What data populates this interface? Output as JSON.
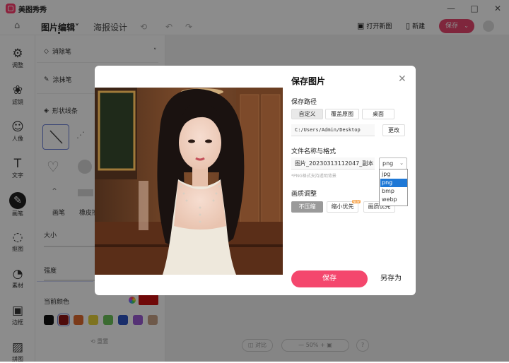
{
  "app": {
    "name": "美图秀秀"
  },
  "window_controls": {
    "minimize": "—",
    "maximize": "□",
    "close": "✕"
  },
  "topbar": {
    "tabs": [
      {
        "label": "图片编辑",
        "caret": "˅"
      },
      {
        "label": "海报设计"
      }
    ],
    "open_new": "打开新图",
    "new": "新建",
    "save": "保存",
    "save_caret": "⌄"
  },
  "left_rail": {
    "items": [
      {
        "label": "调整",
        "icon": "adjust-icon",
        "glyph": "⚙"
      },
      {
        "label": "滤镜",
        "icon": "filter-icon",
        "glyph": "❀"
      },
      {
        "label": "人像",
        "icon": "portrait-icon",
        "glyph": "☺"
      },
      {
        "label": "文字",
        "icon": "text-icon",
        "glyph": "T"
      },
      {
        "label": "画笔",
        "icon": "brush-icon",
        "glyph": "✎",
        "active": true
      },
      {
        "label": "抠图",
        "icon": "cutout-icon",
        "glyph": "◌"
      },
      {
        "label": "素材",
        "icon": "sticker-icon",
        "glyph": "◔"
      },
      {
        "label": "边框",
        "icon": "frame-icon",
        "glyph": "▣"
      },
      {
        "label": "拼图",
        "icon": "collage-icon",
        "glyph": "▨"
      }
    ]
  },
  "tool_panel": {
    "eraser": "消除笔",
    "painter": "涂抹笔",
    "shape_line": "形状线条",
    "pen_tab": "画笔",
    "eraser_tab": "橡皮擦",
    "size": "大小",
    "strength": "强度",
    "current_color": "当前颜色",
    "reset": "重置",
    "current_color_hex": "#cc1111",
    "swatches": [
      "#111111",
      "#8e1414",
      "#e06a2e",
      "#e6d23a",
      "#6cc35a",
      "#2f54c4",
      "#9b5bd6",
      "#c8a387"
    ]
  },
  "canvas_controls": {
    "compare": "对比",
    "zoom": "50%"
  },
  "dialog": {
    "title": "保存图片",
    "path_section": "保存路径",
    "path_options": [
      {
        "label": "自定义",
        "active": true
      },
      {
        "label": "覆盖原图"
      },
      {
        "label": "桌面"
      }
    ],
    "path_value": "C:/Users/Admin/Desktop",
    "change": "更改",
    "name_section": "文件名称与格式",
    "filename": "图片_20230313112047_副本",
    "format": "png",
    "format_options": [
      {
        "label": "jpg"
      },
      {
        "label": "png",
        "selected": true
      },
      {
        "label": "bmp"
      },
      {
        "label": "webp"
      }
    ],
    "hint": "*PNG格式支持透明背景",
    "quality_section": "画质调整",
    "quality_options": [
      {
        "label": "不压缩",
        "active": true
      },
      {
        "label": "缩小优先"
      },
      {
        "label": "画质优先"
      }
    ],
    "save": "保存",
    "save_as": "另存为"
  }
}
